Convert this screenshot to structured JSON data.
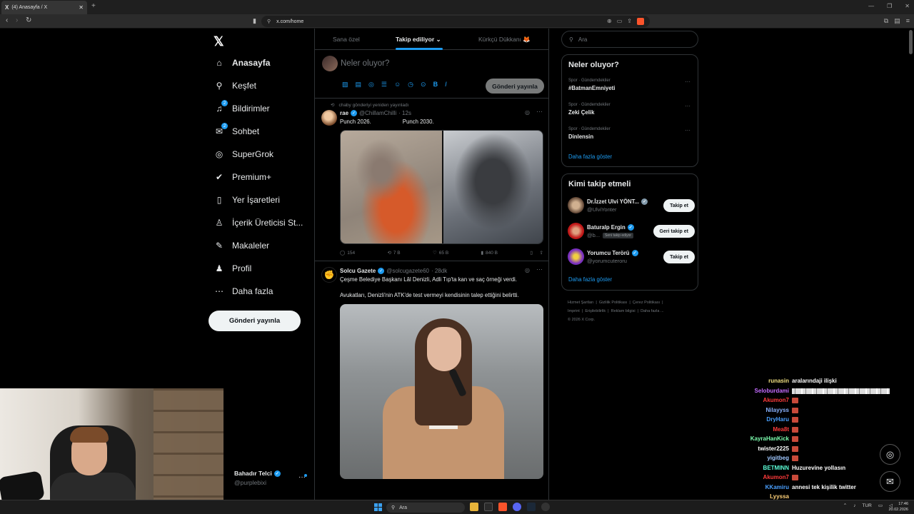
{
  "browser": {
    "tab_title": "(4) Anasayfa / X",
    "tab_icon": "X",
    "url": "x.com/home",
    "new_tab": "+"
  },
  "left_nav": {
    "items": [
      {
        "label": "Anasayfa",
        "icon": "home-icon",
        "active": true
      },
      {
        "label": "Keşfet",
        "icon": "search-icon"
      },
      {
        "label": "Bildirimler",
        "icon": "bell-icon",
        "badge": "2"
      },
      {
        "label": "Sohbet",
        "icon": "mail-icon",
        "badge": "2"
      },
      {
        "label": "SuperGrok",
        "icon": "grok-icon"
      },
      {
        "label": "Premium+",
        "icon": "verified-icon"
      },
      {
        "label": "Yer İşaretleri",
        "icon": "bookmark-icon"
      },
      {
        "label": "İçerik Üreticisi St...",
        "icon": "creator-icon"
      },
      {
        "label": "Makaleler",
        "icon": "article-icon"
      },
      {
        "label": "Profil",
        "icon": "profile-icon"
      },
      {
        "label": "Daha fazla",
        "icon": "more-icon"
      }
    ],
    "post_button": "Gönderi yayınla",
    "account": {
      "name": "Bahadır Telci",
      "handle": "@purplebixi"
    }
  },
  "feed": {
    "tabs": [
      "Sana özel",
      "Takip ediliyor",
      "Kürkçü Dükkanı 🦊"
    ],
    "selected_tab": "Takip ediliyor",
    "composer": {
      "placeholder": "Neler oluyor?",
      "post_button": "Gönderi yayınla"
    },
    "tweets": [
      {
        "repost_note": "chaby gönderiyi yeniden yayınladı",
        "name": "rae",
        "handle": "@ChillamChilli",
        "time": "· 12s",
        "text_left": "Punch 2026.",
        "text_right": "Punch 2030.",
        "replies": "154",
        "reposts": "7 B",
        "likes": "65 B",
        "views": "840 B"
      },
      {
        "name": "Solcu Gazete",
        "handle": "@solcugazete60",
        "time": "· 28dk",
        "text1": "Çeşme Belediye Başkanı Lâl Denizli, Adli Tıp'ta kan ve saç örneği verdi.",
        "text2": "Avukatları, Denizli'nin ATK'de test vermeyi kendisinin talep ettiğini belirtti."
      }
    ]
  },
  "right": {
    "search_placeholder": "Ara",
    "trends_title": "Neler oluyor?",
    "trends": [
      {
        "category": "Spor · Gündemdekiler",
        "name": "#BatmanEmniyeti"
      },
      {
        "category": "Spor · Gündemdekiler",
        "name": "Zeki Çelik"
      },
      {
        "category": "Spor · Gündemdekiler",
        "name": "Dinlensin"
      }
    ],
    "trends_more": "Daha fazla göster",
    "wtf_title": "Kimi takip etmeli",
    "who_to_follow": [
      {
        "name": "Dr.İzzet Ulvi YÖNT...",
        "handle": "@UlviYonter",
        "button": "Takip et"
      },
      {
        "name": "Baturalp Ergin",
        "handle": "@b...",
        "follows_you": "Seni takip ediyor",
        "button": "Geri takip et"
      },
      {
        "name": "Yorumcu Terörü",
        "handle": "@yorumcuteroru",
        "button": "Takip et"
      }
    ],
    "wtf_more": "Daha fazla göster",
    "footer": [
      "Hizmet Şartları",
      "Gizlilik Politikası",
      "Çerez Politikası",
      "Imprint",
      "Erişilebilirlik",
      "Reklam bilgisi",
      "Daha fazla ...",
      "© 2026 X Corp."
    ]
  },
  "chat": [
    {
      "user": "runasin",
      "color": "#f0e080",
      "msg": "aralarındaji ilişki"
    },
    {
      "user": "Seloburdami",
      "color": "#c46cff",
      "msg": "",
      "emote_strip": true
    },
    {
      "user": "Akumon7",
      "color": "#ff3b3b",
      "msg": "",
      "emote": true
    },
    {
      "user": "Nilayyss",
      "color": "#8ab4ff",
      "msg": "",
      "emote": true
    },
    {
      "user": "DryHaru",
      "color": "#4aa0ff",
      "msg": "",
      "emote": true
    },
    {
      "user": "Mea8t",
      "color": "#ff3b3b",
      "msg": "",
      "emote": true
    },
    {
      "user": "KayraHanKick",
      "color": "#7dffb0",
      "msg": "",
      "emote": true
    },
    {
      "user": "twister2225",
      "color": "#ffffff",
      "msg": "",
      "emote": true
    },
    {
      "user": "yigitbeg",
      "color": "#a0c8ff",
      "msg": "",
      "emote": true
    },
    {
      "user": "BETMINN",
      "color": "#5cffd9",
      "msg": "Huzurevine yollasın"
    },
    {
      "user": "Akumon7",
      "color": "#ff3b3b",
      "msg": "",
      "emote": true
    },
    {
      "user": "KKamiru",
      "color": "#4aa0ff",
      "msg": "annesi tek kişilik twitter"
    },
    {
      "user": "Lyyssa",
      "color": "#ffd27a",
      "msg": ""
    }
  ],
  "taskbar": {
    "search": "Ara",
    "lang": "TUR",
    "time": "17:46",
    "date": "20.02.2026"
  }
}
